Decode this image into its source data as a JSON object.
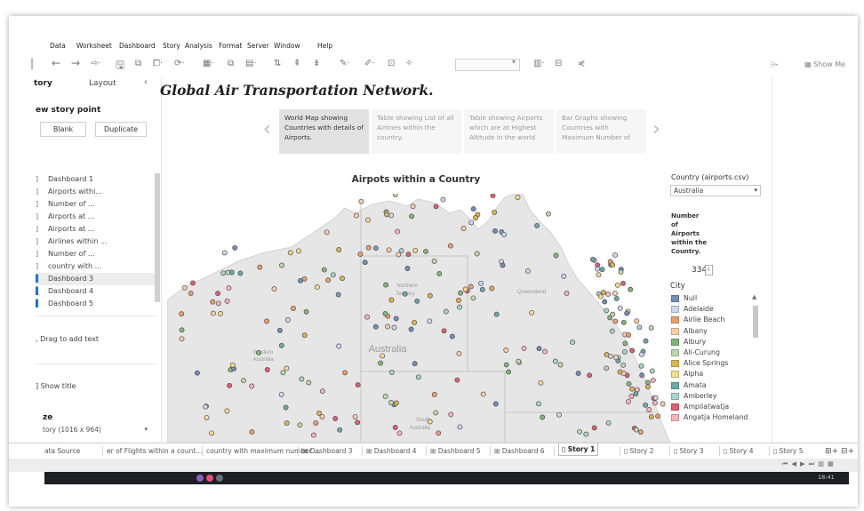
{
  "menu": [
    "Data",
    "Worksheet",
    "Dashboard",
    "Story",
    "Analysis",
    "Format",
    "Server",
    "Window",
    "Help"
  ],
  "toolbar": {
    "icons": [
      "undo-arrow",
      "redo-arrow",
      "forward-icon",
      "save-icon",
      "new-datasource-icon",
      "pause-icon",
      "refresh-icon",
      "new-worksheet-icon",
      "duplicate-icon",
      "clear-icon",
      "swap-icon",
      "sort-asc-icon",
      "sort-desc-icon",
      "highlight-icon",
      "annotate-icon",
      "text-icon",
      "pin-icon",
      "fit-icon",
      "presentation-icon",
      "share-icon"
    ],
    "show_me": "Show Me"
  },
  "left": {
    "tab_story": "tory",
    "tab_layout": "Layout",
    "new_story_point": "ew story point",
    "btn_blank": "Blank",
    "btn_duplicate": "Duplicate",
    "sheets": [
      {
        "label": "Dashboard 1",
        "mark": "]",
        "blue": false
      },
      {
        "label": "Airports withi...",
        "mark": "]",
        "blue": false
      },
      {
        "label": "Number of ...",
        "mark": "]",
        "blue": false
      },
      {
        "label": "Airports at ...",
        "mark": "]",
        "blue": false
      },
      {
        "label": "Airports at ...",
        "mark": "]",
        "blue": false
      },
      {
        "label": "Airlines within ...",
        "mark": "]",
        "blue": false
      },
      {
        "label": "Number of ...",
        "mark": "]",
        "blue": false
      },
      {
        "label": "country with ...",
        "mark": "]",
        "blue": false
      },
      {
        "label": "Dashboard 3",
        "mark": "▌",
        "blue": true
      },
      {
        "label": "Dashboard 4",
        "mark": "▌",
        "blue": true
      },
      {
        "label": "Dashboard 5",
        "mark": "▌",
        "blue": true
      }
    ],
    "drag_text": "Drag to add text",
    "show_title": "Show title",
    "size_label": "ze",
    "size_value": "tory (1016 x 964)"
  },
  "story": {
    "title": "Global Air Transportation Network.",
    "points": [
      "World Map showing Countries with details of Airports.",
      "Table showing List of all Airlines within the country.",
      "Table showing Airports which are at Highest Altitude in the world",
      "Bar Graphs showing Countries with Maximum Number of"
    ],
    "active_point": 0
  },
  "viz": {
    "title": "Airpots within a Country",
    "map_labels": [
      {
        "text": "Northern",
        "size": 6
      },
      {
        "text": "Territory",
        "size": 6
      },
      {
        "text": "Queensland",
        "size": 6
      },
      {
        "text": "Western",
        "size": 6
      },
      {
        "text": "Australia",
        "size": 6
      },
      {
        "text": "Australia",
        "size": 11
      },
      {
        "text": "South",
        "size": 6
      },
      {
        "text": "Australia",
        "size": 6
      }
    ]
  },
  "filters": {
    "country_title": "Country (airports.csv)",
    "country_value": "Australia",
    "number_label": "Number\nof\nAirports\nwithin the\nCountry.",
    "number_value": "334",
    "city_label": "City",
    "cities": [
      {
        "name": "Null",
        "color": "#6f8fb5"
      },
      {
        "name": "Adelaide",
        "color": "#c9d8ea"
      },
      {
        "name": "Airlie Beach",
        "color": "#e8a16a"
      },
      {
        "name": "Albany",
        "color": "#f4cfa6"
      },
      {
        "name": "Albury",
        "color": "#83b57a"
      },
      {
        "name": "Ali-Curung",
        "color": "#b9d9a8"
      },
      {
        "name": "Alice Springs",
        "color": "#d8b64e"
      },
      {
        "name": "Alpha",
        "color": "#f1dd8c"
      },
      {
        "name": "Amata",
        "color": "#6aa9a4"
      },
      {
        "name": "Amberley",
        "color": "#a8d3cb"
      },
      {
        "name": "Ampilatwatja",
        "color": "#d9636e"
      },
      {
        "name": "Angatja Homeland",
        "color": "#f4b5b8"
      }
    ]
  },
  "tabs": [
    {
      "label": "ata Source",
      "icon": "",
      "active": false
    },
    {
      "label": "er of Flights within a count...",
      "icon": "",
      "active": false
    },
    {
      "label": "country with maximum number ...",
      "icon": "",
      "active": false
    },
    {
      "label": "Dashboard 3",
      "icon": "⊞",
      "active": false
    },
    {
      "label": "Dashboard 4",
      "icon": "⊞",
      "active": false
    },
    {
      "label": "Dashboard 5",
      "icon": "⊞",
      "active": false
    },
    {
      "label": "Dashboard 6",
      "icon": "⊞",
      "active": false
    },
    {
      "label": "Story 1",
      "icon": "▯",
      "active": true
    },
    {
      "label": "Story 2",
      "icon": "▯",
      "active": false
    },
    {
      "label": "Story 3",
      "icon": "▯",
      "active": false
    },
    {
      "label": "Story 4",
      "icon": "▯",
      "active": false
    },
    {
      "label": "Story 5",
      "icon": "▯",
      "active": false
    }
  ],
  "status": {
    "time": "18:41"
  }
}
